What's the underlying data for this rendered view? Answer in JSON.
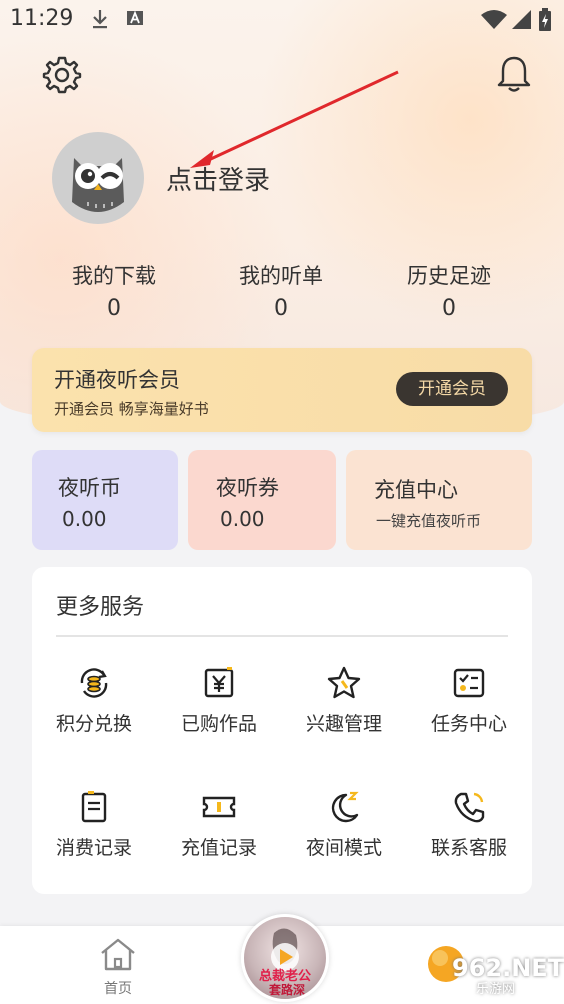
{
  "status_bar": {
    "time": "11:29"
  },
  "header": {
    "settings_icon": "gear-icon",
    "notification_icon": "bell-icon"
  },
  "profile": {
    "login_text": "点击登录",
    "avatar_icon": "owl-avatar"
  },
  "stats": [
    {
      "label": "我的下载",
      "value": "0"
    },
    {
      "label": "我的听单",
      "value": "0"
    },
    {
      "label": "历史足迹",
      "value": "0"
    }
  ],
  "vip": {
    "title": "开通夜听会员",
    "subtitle": "开通会员 畅享海量好书",
    "button": "开通会员"
  },
  "wallet": {
    "coins": {
      "title": "夜听币",
      "value": "0.00"
    },
    "coupons": {
      "title": "夜听券",
      "value": "0.00"
    },
    "recharge": {
      "title": "充值中心",
      "subtitle": "一键充值夜听币"
    }
  },
  "services": {
    "title": "更多服务",
    "items": [
      {
        "label": "积分兑换",
        "icon": "points-exchange-icon"
      },
      {
        "label": "已购作品",
        "icon": "purchased-icon"
      },
      {
        "label": "兴趣管理",
        "icon": "star-icon"
      },
      {
        "label": "任务中心",
        "icon": "task-icon"
      },
      {
        "label": "消费记录",
        "icon": "receipt-icon"
      },
      {
        "label": "充值记录",
        "icon": "ticket-icon"
      },
      {
        "label": "夜间模式",
        "icon": "moon-icon"
      },
      {
        "label": "联系客服",
        "icon": "phone-icon"
      }
    ]
  },
  "bottom_nav": {
    "home": {
      "label": "首页",
      "icon": "home-icon"
    },
    "player_cover_text": [
      "总裁老公",
      "套路深"
    ]
  },
  "watermark": {
    "text": "962.NET",
    "sub": "乐游网"
  },
  "colors": {
    "accent": "#f5b81c",
    "vip_button_bg": "#3a3530",
    "coins_card": "#dedcf7",
    "coupons_card": "#fbd8cf",
    "recharge_card": "#fbe3d2"
  }
}
